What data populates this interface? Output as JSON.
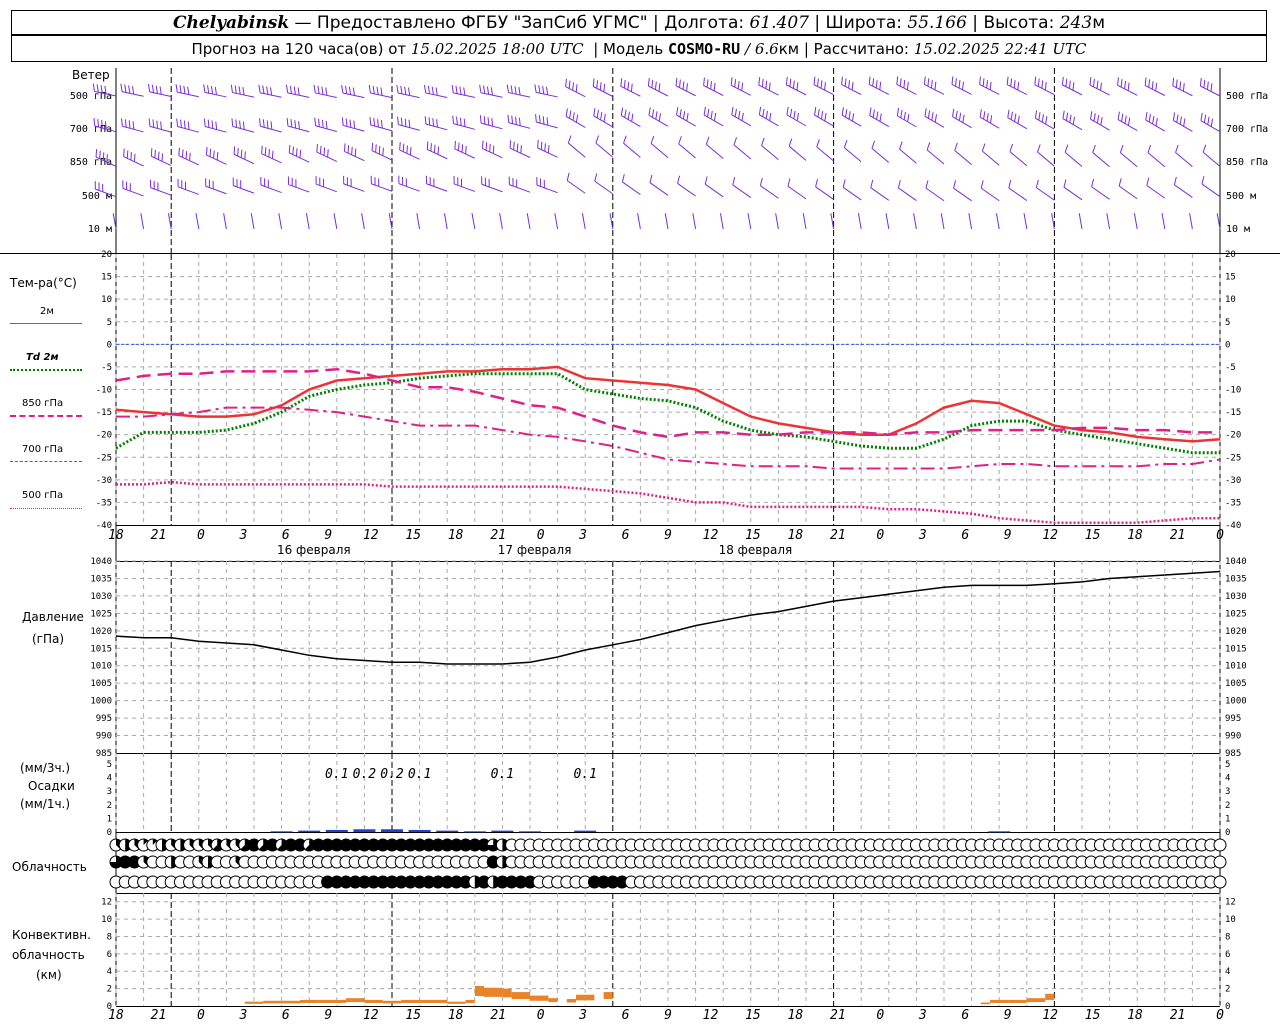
{
  "header": {
    "city": "Chelyabinsk",
    "provider": "— Предоставлено ФГБУ \"ЗапСиб УГМС\"",
    "lon_label": "Долгота:",
    "lon": "61.407",
    "lat_label": "Широта:",
    "lat": "55.166",
    "alt_label": "Высота:",
    "alt": "243",
    "alt_unit": "м",
    "forecast_prefix": "Прогноз на 120 часа(ов) от",
    "forecast_start": "15.02.2025 18:00 UTC",
    "model_label": "Модель",
    "model": "COSMO-RU",
    "resolution": "/ 6.6",
    "resolution_unit": "км",
    "calc_label": "Рассчитано:",
    "calc_time": "15.02.2025 22:41 UTC"
  },
  "time_axis": {
    "hours": [
      "18",
      "21",
      "0",
      "3",
      "6",
      "9",
      "12",
      "15",
      "18",
      "21",
      "0",
      "3",
      "6",
      "9",
      "12",
      "15",
      "18",
      "21",
      "0",
      "3",
      "6",
      "9",
      "12",
      "15",
      "18",
      "21",
      "0"
    ],
    "days": [
      "16 февраля",
      "17 февраля",
      "18 февраля"
    ]
  },
  "wind": {
    "title": "Ветер",
    "levels": [
      "500 гПа",
      "700 гПа",
      "850 гПа",
      "500 м",
      "10 м"
    ]
  },
  "temperature": {
    "title": "Тем-ра(°C)",
    "legend": [
      {
        "label": "2м",
        "color": "#ee3333"
      },
      {
        "label": "Td 2м",
        "color": "#008000"
      },
      {
        "label": "850 гПа",
        "color": "#e0208a"
      },
      {
        "label": "700 гПа",
        "color": "#e0208a"
      },
      {
        "label": "500 гПа",
        "color": "#e0208a"
      }
    ],
    "yticks": [
      "20",
      "15",
      "10",
      "5",
      "0",
      "-5",
      "-10",
      "-15",
      "-20",
      "-25",
      "-30",
      "-35",
      "-40"
    ]
  },
  "pressure": {
    "title": "Давление",
    "unit": "(гПа)",
    "yticks": [
      "1040",
      "1035",
      "1030",
      "1025",
      "1020",
      "1015",
      "1010",
      "1005",
      "1000",
      "995",
      "990",
      "985"
    ]
  },
  "precip": {
    "label1": "(мм/3ч.)",
    "label2": "Осадки",
    "label3": "(мм/1ч.)",
    "yticks": [
      "5",
      "4",
      "3",
      "2",
      "1",
      "0"
    ],
    "amounts": [
      {
        "t": 24,
        "v": "0.1"
      },
      {
        "t": 27,
        "v": "0.2"
      },
      {
        "t": 30,
        "v": "0.2"
      },
      {
        "t": 33,
        "v": "0.1"
      },
      {
        "t": 42,
        "v": "0.1"
      },
      {
        "t": 51,
        "v": "0.1"
      }
    ]
  },
  "clouds": {
    "title": "Облачность"
  },
  "convective": {
    "label1": "Конвективн.",
    "label2": "облачность",
    "label3": "(км)",
    "yticks": [
      "12",
      "10",
      "8",
      "6",
      "4",
      "2",
      "0"
    ]
  },
  "chart_data": [
    {
      "type": "line",
      "title": "Тем-ра(°C)",
      "x_unit": "hours from forecast start (15.02.2025 18:00 UTC)",
      "ylim": [
        -40,
        20
      ],
      "x": [
        0,
        3,
        6,
        9,
        12,
        15,
        18,
        21,
        24,
        27,
        30,
        33,
        36,
        39,
        42,
        45,
        48,
        51,
        54,
        57,
        60,
        63,
        66,
        69,
        72,
        75,
        78,
        81,
        84,
        87,
        90,
        93,
        96,
        99,
        102,
        105,
        108,
        111,
        114,
        117,
        120
      ],
      "series": [
        {
          "name": "2м",
          "values": [
            -14.5,
            -15,
            -15.5,
            -16,
            -16,
            -15.5,
            -13.5,
            -10,
            -8,
            -7.5,
            -7,
            -6.5,
            -6,
            -6,
            -5.5,
            -5.5,
            -5,
            -7.5,
            -8,
            -8.5,
            -9,
            -10,
            -13,
            -16,
            -17.5,
            -18.5,
            -19.5,
            -20,
            -20,
            -17.5,
            -14,
            -12.5,
            -13,
            -15.5,
            -18,
            -19,
            -19.5,
            -20.5,
            -21,
            -21.5,
            -21
          ]
        },
        {
          "name": "Td 2м",
          "values": [
            -23,
            -19.5,
            -19.5,
            -19.5,
            -19,
            -17.5,
            -15,
            -11.5,
            -10,
            -9,
            -8.5,
            -7.5,
            -7,
            -6.5,
            -6.5,
            -6.5,
            -6.5,
            -10,
            -11,
            -12,
            -12.5,
            -14,
            -17,
            -19,
            -20,
            -20.5,
            -21.5,
            -22.5,
            -23,
            -23,
            -21,
            -18,
            -17,
            -17,
            -19,
            -20,
            -21,
            -22,
            -23,
            -24,
            -24
          ]
        },
        {
          "name": "850 гПа",
          "values": [
            -8,
            -7,
            -6.5,
            -6.5,
            -6,
            -6,
            -6,
            -6,
            -5.5,
            -6.5,
            -8,
            -9.5,
            -9.5,
            -10.5,
            -12,
            -13.5,
            -14,
            -16,
            -18,
            -19.5,
            -20.5,
            -19.5,
            -19.5,
            -20,
            -20,
            -19.5,
            -19.5,
            -19.5,
            -20,
            -19.5,
            -19.5,
            -19,
            -19,
            -19,
            -19,
            -18.5,
            -18.5,
            -19,
            -19,
            -19.5,
            -19.5
          ]
        },
        {
          "name": "700 гПа",
          "values": [
            -16,
            -16,
            -15.5,
            -15,
            -14,
            -14,
            -14,
            -14.5,
            -15,
            -16,
            -17,
            -18,
            -18,
            -18,
            -19,
            -20,
            -20.5,
            -21.5,
            -22.5,
            -24,
            -25.5,
            -26,
            -26.5,
            -27,
            -27,
            -27,
            -27.5,
            -27.5,
            -27.5,
            -27.5,
            -27.5,
            -27,
            -26.5,
            -26.5,
            -27,
            -27,
            -27,
            -27,
            -26.5,
            -26.5,
            -25.5
          ]
        },
        {
          "name": "500 гПа",
          "values": [
            -31,
            -31,
            -30.5,
            -31,
            -31,
            -31,
            -31,
            -31,
            -31,
            -31,
            -31.5,
            -31.5,
            -31.5,
            -31.5,
            -31.5,
            -31.5,
            -31.5,
            -32,
            -32.5,
            -33,
            -34,
            -35,
            -35,
            -36,
            -36,
            -36,
            -36,
            -36,
            -36.5,
            -36.5,
            -37,
            -37.5,
            -38.5,
            -39,
            -39.5,
            -39.5,
            -39.5,
            -39.5,
            -39,
            -38.5,
            -38.5
          ]
        }
      ]
    },
    {
      "type": "line",
      "title": "Давление",
      "ylabel": "(гПа)",
      "ylim": [
        985,
        1040
      ],
      "x": [
        0,
        3,
        6,
        9,
        12,
        15,
        18,
        21,
        24,
        27,
        30,
        33,
        36,
        39,
        42,
        45,
        48,
        51,
        54,
        57,
        60,
        63,
        66,
        69,
        72,
        75,
        78,
        81,
        84,
        87,
        90,
        93,
        96,
        99,
        102,
        105,
        108,
        111,
        114,
        117,
        120
      ],
      "series": [
        {
          "name": "Давление",
          "values": [
            1018.5,
            1018,
            1018,
            1017,
            1016.5,
            1016,
            1014.5,
            1013,
            1012,
            1011.5,
            1011,
            1011,
            1010.5,
            1010.5,
            1010.5,
            1011,
            1012.5,
            1014.5,
            1016,
            1017.5,
            1019.5,
            1021.5,
            1023,
            1024.5,
            1025.5,
            1027,
            1028.5,
            1029.5,
            1030.5,
            1031.5,
            1032.5,
            1033,
            1033,
            1033,
            1033.5,
            1034,
            1035,
            1035.5,
            1036,
            1036.5,
            1037
          ]
        }
      ]
    },
    {
      "type": "bar",
      "title": "Осадки",
      "ylabel": "(мм/3ч.)",
      "ylim": [
        0,
        5
      ],
      "x": [
        18,
        21,
        24,
        27,
        30,
        33,
        36,
        39,
        42,
        45,
        51,
        96
      ],
      "values": [
        0.05,
        0.1,
        0.15,
        0.2,
        0.2,
        0.15,
        0.1,
        0.05,
        0.1,
        0.05,
        0.1,
        0.05
      ]
    },
    {
      "type": "bar",
      "title": "Конвективн. облачность",
      "ylabel": "(км)",
      "ylim": [
        0,
        13
      ],
      "bars": [
        {
          "x0": 14,
          "x1": 16,
          "v": 0.5
        },
        {
          "x0": 16,
          "x1": 18,
          "v": 0.6
        },
        {
          "x0": 18,
          "x1": 20,
          "v": 0.6
        },
        {
          "x0": 20,
          "x1": 22,
          "v": 0.7
        },
        {
          "x0": 22,
          "x1": 25,
          "v": 0.7
        },
        {
          "x0": 25,
          "x1": 27,
          "v": 0.9
        },
        {
          "x0": 27,
          "x1": 29,
          "v": 0.7
        },
        {
          "x0": 29,
          "x1": 31,
          "v": 0.6
        },
        {
          "x0": 31,
          "x1": 33,
          "v": 0.7
        },
        {
          "x0": 33,
          "x1": 36,
          "v": 0.7
        },
        {
          "x0": 36,
          "x1": 38,
          "v": 0.5
        },
        {
          "x0": 38,
          "x1": 39,
          "v": 0.7
        },
        {
          "x0": 39,
          "x1": 40,
          "v": 2.3
        },
        {
          "x0": 40,
          "x1": 42,
          "v": 2.1
        },
        {
          "x0": 42,
          "x1": 43,
          "v": 2.0
        },
        {
          "x0": 43,
          "x1": 45,
          "v": 1.6
        },
        {
          "x0": 45,
          "x1": 47,
          "v": 1.2
        },
        {
          "x0": 47,
          "x1": 48,
          "v": 0.9
        },
        {
          "x0": 49,
          "x1": 50,
          "v": 0.8
        },
        {
          "x0": 50,
          "x1": 52,
          "v": 1.3
        },
        {
          "x0": 53,
          "x1": 54,
          "v": 1.6
        },
        {
          "x0": 94,
          "x1": 95,
          "v": 0.4
        },
        {
          "x0": 95,
          "x1": 97,
          "v": 0.7
        },
        {
          "x0": 97,
          "x1": 99,
          "v": 0.7
        },
        {
          "x0": 99,
          "x1": 101,
          "v": 0.9
        },
        {
          "x0": 101,
          "x1": 102,
          "v": 1.4
        }
      ]
    },
    {
      "type": "table",
      "title": "Облачность",
      "x": [
        0,
        1,
        2,
        3,
        4,
        5,
        6,
        7,
        8,
        9,
        10,
        11,
        12,
        13,
        14,
        15,
        16,
        17,
        18,
        19,
        20,
        21,
        22,
        23,
        24,
        25,
        26,
        27,
        28,
        29,
        30,
        31,
        32,
        33,
        34,
        35,
        36,
        37,
        38,
        39,
        40,
        41,
        42,
        43,
        44,
        45,
        46,
        47,
        48,
        49,
        50,
        51,
        52,
        53,
        54,
        55,
        56,
        57,
        58,
        59,
        60,
        61,
        62,
        63,
        64,
        65,
        66,
        67,
        68,
        69,
        70,
        71,
        72,
        73,
        74,
        75,
        76,
        77,
        78,
        79,
        80,
        81,
        82,
        83,
        84,
        85,
        86,
        87,
        88,
        89,
        90,
        91,
        92,
        93,
        94,
        95,
        96,
        97,
        98,
        99,
        100,
        101,
        102,
        103,
        104,
        105,
        106,
        107,
        108,
        109,
        110,
        111,
        112,
        113,
        114,
        115,
        116,
        117,
        118,
        119,
        120
      ],
      "rows_tenths_upper_middle_lower": [
        "3,4,3,1,1,4,3,4,3,3,3,5,3,3,5,8,5,8,5,8,8,5,8,8,8,8,8,8,8,8,8,8,8,8,8,8,8,8,8,8,8,6,4,0,0,0,0,0,0,0,0,0,0,0,0,0,0,0,0,0,0,0,0,0,0,0,0,0,0,0,0,0,0,0,0,0,0,0,0,0,0,0,0,0,0,0,0,0,0,0,0,0,0,0,0,0,0,0,0,0,0,0,0,0,0,0,0,0,0,0,0,0,0,0,0,0,0,0,0,0,0",
        "6,8,8,3,0,0,4,0,0,3,4,0,0,3,0,0,0,0,0,0,0,0,0,0,0,0,0,0,0,0,0,0,0,0,0,0,0,0,0,0,0,8,4,0,0,0,0,0,0,0,0,0,0,0,0,0,0,0,0,0,0,0,0,0,0,0,0,0,0,0,0,0,0,0,0,0,0,0,0,0,0,0,0,0,0,0,0,0,0,0,0,0,0,0,0,0,0,0,0,0,0,0,0,0,0,0,0,0,0,0,0,0,0,0,0,0,0,0,0,0,0",
        "0,0,0,0,0,0,0,0,0,0,0,0,0,0,0,0,0,0,0,0,0,0,0,8,8,8,8,8,8,8,8,8,8,8,8,8,8,8,8,4,8,4,8,8,8,8,0,0,0,0,0,0,8,8,8,8,0,0,0,0,0,0,0,0,0,0,0,0,0,0,0,0,0,0,0,0,0,0,0,0,0,0,0,0,0,0,0,0,0,0,0,0,0,0,0,0,0,0,0,0,0,0,0,0,0,0,0,0,0,0,0,0,0,0,0,0,0,0,0,0,0"
      ]
    }
  ]
}
